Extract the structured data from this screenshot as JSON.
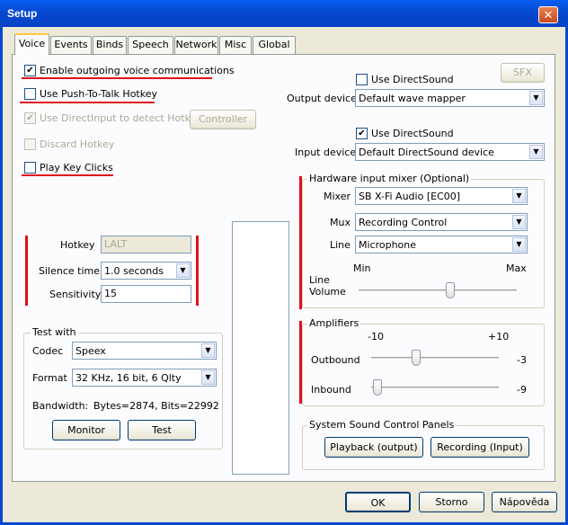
{
  "window": {
    "title": "Setup",
    "close_glyph": "✕"
  },
  "tabs": [
    {
      "label": "Voice",
      "active": true
    },
    {
      "label": "Events"
    },
    {
      "label": "Binds"
    },
    {
      "label": "Speech"
    },
    {
      "label": "Network"
    },
    {
      "label": "Misc"
    },
    {
      "label": "Global"
    }
  ],
  "voice": {
    "enable_outgoing": {
      "label": "Enable outgoing voice communications",
      "checked": true
    },
    "push_to_talk": {
      "label": "Use Push-To-Talk Hotkey",
      "checked": false
    },
    "directinput": {
      "label": "Use DirectInput to detect Hotkey",
      "checked": true,
      "disabled": true
    },
    "controller_button": "Controller",
    "discard_hotkey": {
      "label": "Discard Hotkey",
      "checked": false,
      "disabled": true
    },
    "key_clicks": {
      "label": "Play Key Clicks",
      "checked": false
    },
    "hotkey": {
      "label": "Hotkey",
      "value": "LALT"
    },
    "silence_time": {
      "label": "Silence time",
      "value": "1.0 seconds"
    },
    "sensitivity": {
      "label": "Sensitivity",
      "value": "15"
    }
  },
  "test_with": {
    "title": "Test with",
    "codec": {
      "label": "Codec",
      "value": "Speex"
    },
    "format": {
      "label": "Format",
      "value": "32 KHz, 16 bit, 6 Qlty"
    },
    "bandwidth": {
      "label": "Bandwidth:",
      "value": "Bytes=2874, Bits=22992"
    },
    "monitor_button": "Monitor",
    "test_button": "Test"
  },
  "output": {
    "directsound": {
      "label": "Use DirectSound",
      "checked": false
    },
    "sfx_button": "SFX",
    "device": {
      "label": "Output device",
      "value": "Default wave mapper"
    }
  },
  "input": {
    "directsound": {
      "label": "Use DirectSound",
      "checked": true
    },
    "device": {
      "label": "Input device",
      "value": "Default DirectSound device"
    }
  },
  "mixer": {
    "title": "Hardware input mixer (Optional)",
    "mixer": {
      "label": "Mixer",
      "value": "SB X-Fi Audio [EC00]"
    },
    "mux": {
      "label": "Mux",
      "value": "Recording Control"
    },
    "line": {
      "label": "Line",
      "value": "Microphone"
    },
    "min_label": "Min",
    "max_label": "Max",
    "volume_label_1": "Line",
    "volume_label_2": "Volume",
    "volume_fraction": 0.58
  },
  "amplifiers": {
    "title": "Amplifiers",
    "min_label": "-10",
    "max_label": "+10",
    "outbound": {
      "label": "Outbound",
      "value": "-3",
      "numeric": -3
    },
    "inbound": {
      "label": "Inbound",
      "value": "-9",
      "numeric": -9
    }
  },
  "sound_panels": {
    "title": "System Sound Control Panels",
    "playback_button": "Playback (output)",
    "recording_button": "Recording (Input)"
  },
  "footer": {
    "ok_button": "OK",
    "cancel_button": "Storno",
    "help_button": "Nápověda"
  },
  "colors": {
    "titlebar": "#0648d0",
    "annotation_red": "#e0101a",
    "tab_highlight": "#ffc83c"
  }
}
